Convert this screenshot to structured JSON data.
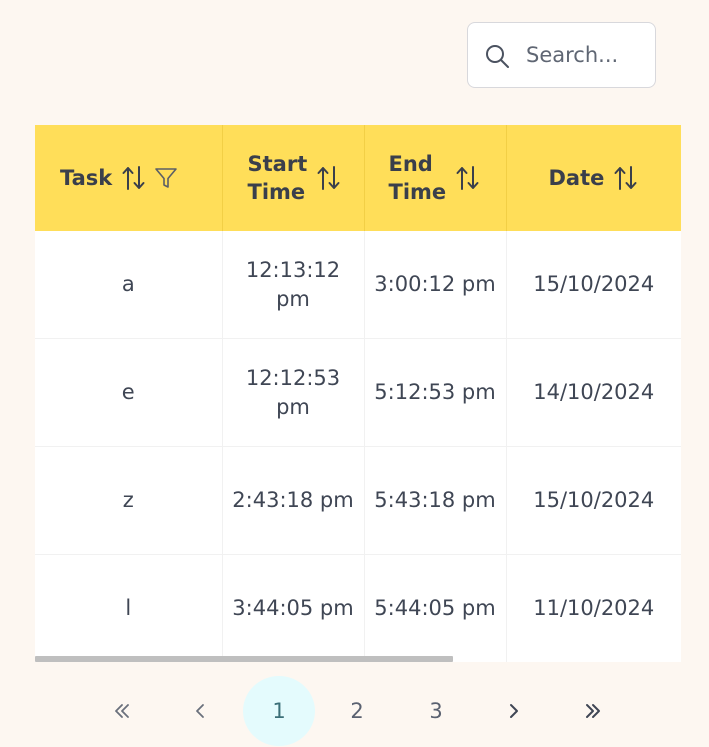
{
  "search": {
    "placeholder": "Search..."
  },
  "table": {
    "columns": [
      {
        "label": "Task"
      },
      {
        "label_line1": "Start",
        "label_line2": "Time"
      },
      {
        "label_line1": "End",
        "label_line2": "Time"
      },
      {
        "label": "Date"
      }
    ],
    "rows": [
      {
        "task": "a",
        "start_time": "12:13:12 pm",
        "end_time": "3:00:12 pm",
        "date": "15/10/2024"
      },
      {
        "task": "e",
        "start_time": "12:12:53 pm",
        "end_time": "5:12:53 pm",
        "date": "14/10/2024"
      },
      {
        "task": "z",
        "start_time": "2:43:18 pm",
        "end_time": "5:43:18 pm",
        "date": "15/10/2024"
      },
      {
        "task": "l",
        "start_time": "3:44:05 pm",
        "end_time": "5:44:05 pm",
        "date": "11/10/2024"
      }
    ]
  },
  "pagination": {
    "pages": [
      "1",
      "2",
      "3"
    ],
    "current": "1",
    "active_color": "#e4fbfd"
  },
  "colors": {
    "header_bg": "#ffde59",
    "page_bg": "#fdf7f1"
  },
  "icons": [
    "search-icon",
    "sort-icon",
    "filter-icon",
    "first-page-icon",
    "prev-page-icon",
    "next-page-icon",
    "last-page-icon"
  ]
}
